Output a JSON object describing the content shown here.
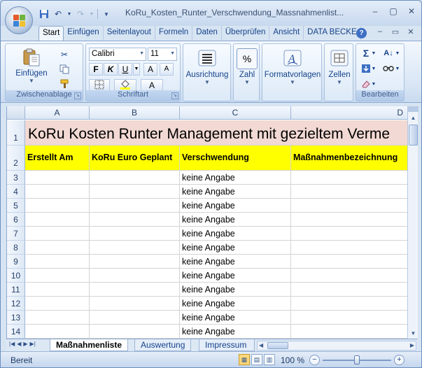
{
  "window": {
    "title": "KoRu_Kosten_Runter_Verschwendung_Massnahmenlist... M",
    "controls": [
      "–",
      "▢",
      "✕"
    ]
  },
  "quick_access": [
    "save-icon",
    "undo-icon",
    "redo-icon",
    "customize-icon"
  ],
  "ribbon_tabs": [
    {
      "label": "Start",
      "active": true
    },
    {
      "label": "Einfügen"
    },
    {
      "label": "Seitenlayout"
    },
    {
      "label": "Formeln"
    },
    {
      "label": "Daten"
    },
    {
      "label": "Überprüfen"
    },
    {
      "label": "Ansicht"
    },
    {
      "label": "DATA BECKE"
    }
  ],
  "ribbon": {
    "clipboard": {
      "paste_label": "Einfügen",
      "group_label": "Zwischenablage"
    },
    "font": {
      "font_name": "Calibri",
      "font_size": "11",
      "bold": "F",
      "italic": "K",
      "underline": "U",
      "grow": "A",
      "shrink": "A",
      "font_color": "A",
      "group_label": "Schriftart"
    },
    "alignment": {
      "label": "Ausrichtung"
    },
    "number": {
      "label": "Zahl",
      "symbol": "%"
    },
    "styles": {
      "label": "Formatvorlagen"
    },
    "cells": {
      "label": "Zellen"
    },
    "editing": {
      "group_label": "Bearbeiten",
      "sum_symbol": "Σ"
    }
  },
  "grid": {
    "columns": [
      "A",
      "B",
      "C",
      "D"
    ],
    "title": "KoRu Kosten Runter Management mit gezieltem Verme",
    "headers": [
      "Erstellt Am",
      "KoRu Euro Geplant",
      "Verschwendung",
      "Maßnahmenbezeichnung"
    ],
    "row_numbers": [
      "1",
      "2",
      "3",
      "4",
      "5",
      "6",
      "7",
      "8",
      "9",
      "10",
      "11",
      "12",
      "13",
      "14"
    ],
    "rows": [
      [
        "",
        "",
        "keine Angabe",
        ""
      ],
      [
        "",
        "",
        "keine Angabe",
        ""
      ],
      [
        "",
        "",
        "keine Angabe",
        ""
      ],
      [
        "",
        "",
        "keine Angabe",
        ""
      ],
      [
        "",
        "",
        "keine Angabe",
        ""
      ],
      [
        "",
        "",
        "keine Angabe",
        ""
      ],
      [
        "",
        "",
        "keine Angabe",
        ""
      ],
      [
        "",
        "",
        "keine Angabe",
        ""
      ],
      [
        "",
        "",
        "keine Angabe",
        ""
      ],
      [
        "",
        "",
        "keine Angabe",
        ""
      ],
      [
        "",
        "",
        "keine Angabe",
        ""
      ],
      [
        "",
        "",
        "keine Angabe",
        ""
      ]
    ],
    "title_fill": "#f2d9d3",
    "header_fill": "#ffff00"
  },
  "sheets": [
    {
      "label": "Maßnahmenliste",
      "active": true
    },
    {
      "label": "Auswertung"
    },
    {
      "label": "Impressum"
    }
  ],
  "status": {
    "text": "Bereit",
    "zoom": "100 %",
    "zoom_level": 0.5
  }
}
